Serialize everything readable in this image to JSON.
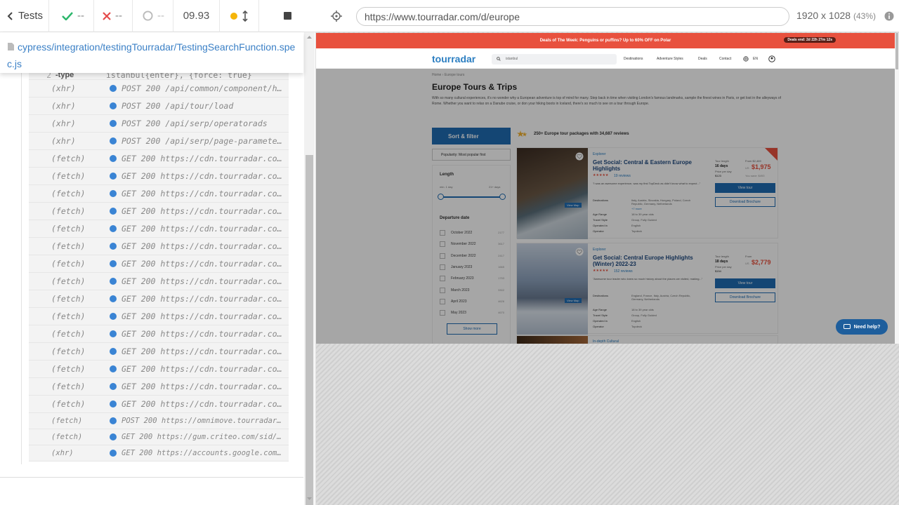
{
  "reporter": {
    "tests_label": "Tests",
    "passed": "--",
    "failed": "--",
    "pending": "--",
    "duration": "09.93",
    "spec_path": "cypress/integration/testingTourradar/TestingSearchFunction.spec.js",
    "first_row": {
      "num": "2",
      "name": "-type",
      "msg": "istanbul{enter}, {force: true}"
    },
    "rows": [
      {
        "event": "(xhr)",
        "msg": "POST 200 /api/common/component/header"
      },
      {
        "event": "(xhr)",
        "msg": "POST 200 /api/tour/load"
      },
      {
        "event": "(xhr)",
        "msg": "POST 200 /api/serp/operatorads"
      },
      {
        "event": "(xhr)",
        "msg": "POST 200 /api/serp/page-parameters"
      },
      {
        "event": "(fetch)",
        "msg": "GET 200 https://cdn.tourradar.com/s3/"
      },
      {
        "event": "(fetch)",
        "msg": "GET 200 https://cdn.tourradar.com/s3/"
      },
      {
        "event": "(fetch)",
        "msg": "GET 200 https://cdn.tourradar.com/s3/"
      },
      {
        "event": "(fetch)",
        "msg": "GET 200 https://cdn.tourradar.com/s3/"
      },
      {
        "event": "(fetch)",
        "msg": "GET 200 https://cdn.tourradar.com/s3/"
      },
      {
        "event": "(fetch)",
        "msg": "GET 200 https://cdn.tourradar.com/s3/"
      },
      {
        "event": "(fetch)",
        "msg": "GET 200 https://cdn.tourradar.com/s3/"
      },
      {
        "event": "(fetch)",
        "msg": "GET 200 https://cdn.tourradar.com/s3/"
      },
      {
        "event": "(fetch)",
        "msg": "GET 200 https://cdn.tourradar.com/s3/"
      },
      {
        "event": "(fetch)",
        "msg": "GET 200 https://cdn.tourradar.com/s3/"
      },
      {
        "event": "(fetch)",
        "msg": "GET 200 https://cdn.tourradar.com/s3/"
      },
      {
        "event": "(fetch)",
        "msg": "GET 200 https://cdn.tourradar.com/s3/"
      },
      {
        "event": "(fetch)",
        "msg": "GET 200 https://cdn.tourradar.com/s3/"
      },
      {
        "event": "(fetch)",
        "msg": "GET 200 https://cdn.tourradar.com/s3/"
      },
      {
        "event": "(fetch)",
        "msg": "GET 200 https://cdn.tourradar.com/s3/"
      },
      {
        "event": "(fetch)",
        "msg": "POST 200 https://omnimove.tourradar.com/a"
      },
      {
        "event": "(fetch)",
        "msg": "GET 200 https://gum.criteo.com/sid/json?o"
      },
      {
        "event": "(xhr)",
        "msg": "GET 200 https://accounts.google.com/o/oau"
      }
    ]
  },
  "aut": {
    "url": "https://www.tourradar.com/d/europe",
    "viewport": "1920 x 1028",
    "zoom": "(43%)",
    "promo_text": "Deals of The Week: Penguins or puffins? Up to 60% OFF on Polar",
    "promo_timer": "Deals end: 2d 22h 27m 12s",
    "logo": "tourradar",
    "search_value": "istanbul",
    "nav": [
      "Destinations",
      "Adventure Styles",
      "Deals",
      "Contact",
      "EN"
    ],
    "breadcrumb": "Home › Europe tours",
    "page_title": "Europe Tours & Trips",
    "intro": "With so many cultural experiences, it's no wonder why a European adventure is top of mind for many. Step back in time when visiting London's famous landmarks, sample the finest wines in Paris, or get lost in the alleyways of Rome. Whether you want to relax on a Danube cruise, or don your hiking boots in Iceland, there's so much to see on a tour through Europe.",
    "sort_filter": "Sort & filter",
    "packages": "250+ Europe tour packages with 34,687 reviews",
    "sort_select": "Popularity: Most popular first",
    "filter_length": "Length",
    "length_min": "min. 1 day",
    "length_max": "21+ days",
    "filter_departure": "Departure date",
    "months": [
      {
        "label": "October 2022",
        "count": "2177"
      },
      {
        "label": "November 2022",
        "count": "3617"
      },
      {
        "label": "December 2022",
        "count": "2417"
      },
      {
        "label": "January 2023",
        "count": "1665"
      },
      {
        "label": "February 2023",
        "count": "1753"
      },
      {
        "label": "March 2023",
        "count": "3302"
      },
      {
        "label": "April 2023",
        "count": "4626"
      },
      {
        "label": "May 2023",
        "count": "4670"
      }
    ],
    "show_more": "Show more",
    "tours": [
      {
        "operator": "Explorer",
        "title": "Get Social: Central & Eastern Europe Highlights",
        "reviews": "19 reviews",
        "quote": "\"I was an awesome experience, was my first TopDeck as didn't know what to expect...\"",
        "destinations": "Italy, Austria, Slovakia, Hungary, Poland, Czech Republic, Germany, Netherlands",
        "more": "+7 more",
        "age": "18 to 39 year olds",
        "style": "Group, Fully Guided",
        "operated": "English",
        "operator_name": "Topdeck",
        "length": "16 days",
        "price_per_day": "$123",
        "from": "From $2,469",
        "price": "$1,975",
        "save": "You save: $493",
        "map": "View Map"
      },
      {
        "operator": "Explorer",
        "title": "Get Social: Central Europe Highlights (Winter) 2022-23",
        "reviews": "152 reviews",
        "quote": "\"Awesome tour leader who knew so much history about the places we visited, making...\"",
        "destinations": "England, France, Italy, Austria, Czech Republic, Germany, Netherlands",
        "more": "",
        "age": "18 to 39 year olds",
        "style": "Group, Fully Guided",
        "operated": "English",
        "operator_name": "Topdeck",
        "length": "18 days",
        "price_per_day": "$154",
        "from": "From",
        "price": "$2,779",
        "save": "",
        "map": "View Map"
      }
    ],
    "third_operator": "In-depth Cultural",
    "labels": {
      "tour_length": "Tour length",
      "price_per_day_label": "Price per day",
      "view_tour": "View tour",
      "download": "Download Brochure",
      "destinations": "Destinations",
      "age": "Age Range",
      "style": "Travel Style",
      "operated": "Operated in",
      "operator": "Operator",
      "us": "US"
    },
    "need_help": "Need help?"
  }
}
